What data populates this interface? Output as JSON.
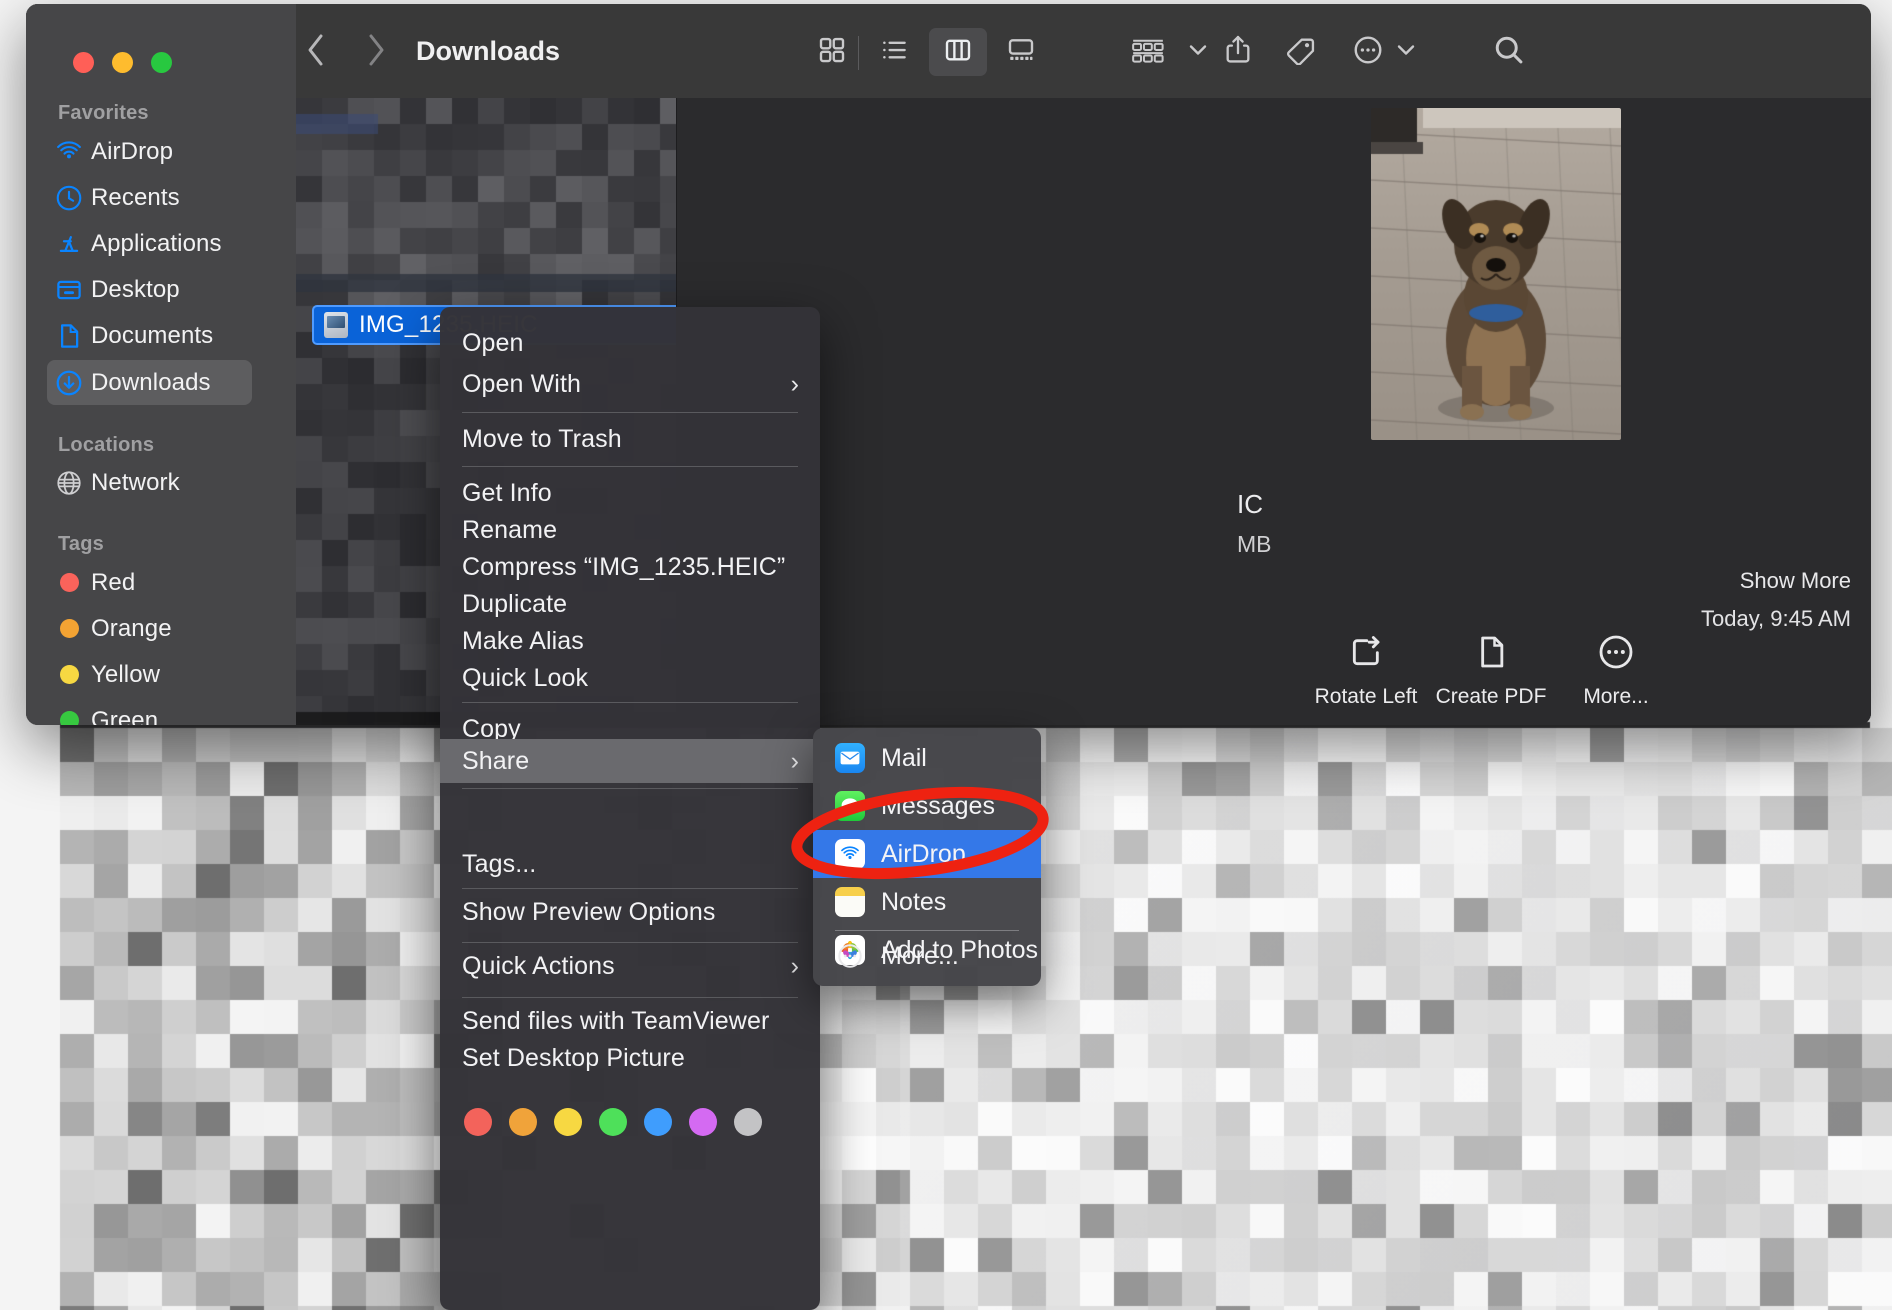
{
  "window": {
    "title": "Downloads",
    "traffic_lights": [
      "close",
      "minimize",
      "maximize"
    ]
  },
  "toolbar": {
    "back_icon": "chevron-left-icon",
    "forward_icon": "chevron-right-icon",
    "view_icon_grid": "icon-view-icon",
    "view_list": "list-view-icon",
    "view_column": "column-view-icon",
    "view_gallery": "gallery-view-icon",
    "group_icon": "group-items-icon",
    "group_chevron": "chevron-down-icon",
    "share_icon": "share-icon",
    "tag_icon": "tag-icon",
    "more_icon": "ellipsis-circle-icon",
    "more_chevron": "chevron-down-icon",
    "search_icon": "search-icon",
    "active_view": "column"
  },
  "sidebar": {
    "sections": [
      {
        "header": "Favorites",
        "items": [
          {
            "label": "AirDrop",
            "icon": "airdrop-icon",
            "selected": false
          },
          {
            "label": "Recents",
            "icon": "clock-icon",
            "selected": false
          },
          {
            "label": "Applications",
            "icon": "applications-icon",
            "selected": false
          },
          {
            "label": "Desktop",
            "icon": "desktop-icon",
            "selected": false
          },
          {
            "label": "Documents",
            "icon": "document-icon",
            "selected": false
          },
          {
            "label": "Downloads",
            "icon": "downloads-icon",
            "selected": true
          }
        ]
      },
      {
        "header": "Locations",
        "items": [
          {
            "label": "Network",
            "icon": "globe-icon",
            "selected": false
          }
        ]
      },
      {
        "header": "Tags",
        "items": [
          {
            "label": "Red",
            "icon": "tag-dot-icon",
            "color": "#f9635b",
            "selected": false
          },
          {
            "label": "Orange",
            "icon": "tag-dot-icon",
            "color": "#f3a333",
            "selected": false
          },
          {
            "label": "Yellow",
            "icon": "tag-dot-icon",
            "color": "#f7d842",
            "selected": false
          },
          {
            "label": "Green",
            "icon": "tag-dot-icon",
            "color": "#37c940",
            "selected": false
          }
        ]
      }
    ]
  },
  "file": {
    "name": "IMG_1235.HEIC",
    "icon": "heic-file-icon",
    "selected": true
  },
  "preview": {
    "image_alt": "dog-photo-preview",
    "name_fragment": "IC",
    "size_fragment": "MB",
    "show_more": "Show More",
    "date": "Today, 9:45 AM",
    "actions": [
      {
        "label": "Rotate Left",
        "icon": "rotate-left-icon"
      },
      {
        "label": "Create PDF",
        "icon": "create-pdf-icon"
      },
      {
        "label": "More...",
        "icon": "ellipsis-circle-icon"
      }
    ]
  },
  "context_menu": {
    "items": [
      {
        "label": "Open",
        "submenu": false,
        "highlighted": false
      },
      {
        "label": "Open With",
        "submenu": true,
        "highlighted": false
      },
      {
        "label": "Move to Trash",
        "submenu": false,
        "highlighted": false
      },
      {
        "label": "Get Info",
        "submenu": false,
        "highlighted": false
      },
      {
        "label": "Rename",
        "submenu": false,
        "highlighted": false
      },
      {
        "label": "Compress “IMG_1235.HEIC”",
        "submenu": false,
        "highlighted": false
      },
      {
        "label": "Duplicate",
        "submenu": false,
        "highlighted": false
      },
      {
        "label": "Make Alias",
        "submenu": false,
        "highlighted": false
      },
      {
        "label": "Quick Look",
        "submenu": false,
        "highlighted": false
      },
      {
        "label": "Copy",
        "submenu": false,
        "highlighted": false
      },
      {
        "label": "Share",
        "submenu": true,
        "highlighted": true
      },
      {
        "label": "Tags...",
        "submenu": false,
        "highlighted": false
      },
      {
        "label": "Show Preview Options",
        "submenu": false,
        "highlighted": false
      },
      {
        "label": "Quick Actions",
        "submenu": true,
        "highlighted": false
      },
      {
        "label": "Send files with TeamViewer",
        "submenu": false,
        "highlighted": false
      },
      {
        "label": "Set Desktop Picture",
        "submenu": false,
        "highlighted": false
      }
    ],
    "tag_colors": [
      "#f3635b",
      "#f0a33a",
      "#f7d842",
      "#4ee05a",
      "#3f9dfd",
      "#d46af2",
      "#c3c3c5"
    ],
    "submenu_arrow": "chevron-right-icon"
  },
  "share_menu": {
    "items": [
      {
        "label": "Mail",
        "icon": "mail-icon",
        "selected": false
      },
      {
        "label": "Messages",
        "icon": "messages-icon",
        "selected": false
      },
      {
        "label": "AirDrop",
        "icon": "airdrop-icon",
        "selected": true
      },
      {
        "label": "Notes",
        "icon": "notes-icon",
        "selected": false
      },
      {
        "label": "Add to Photos",
        "icon": "photos-icon",
        "selected": false
      },
      {
        "label": "More...",
        "icon": "ellipsis-circle-icon",
        "selected": false
      }
    ]
  },
  "annotation": {
    "shape": "red-ellipse-highlight",
    "color": "#ee2211",
    "target": "AirDrop"
  }
}
